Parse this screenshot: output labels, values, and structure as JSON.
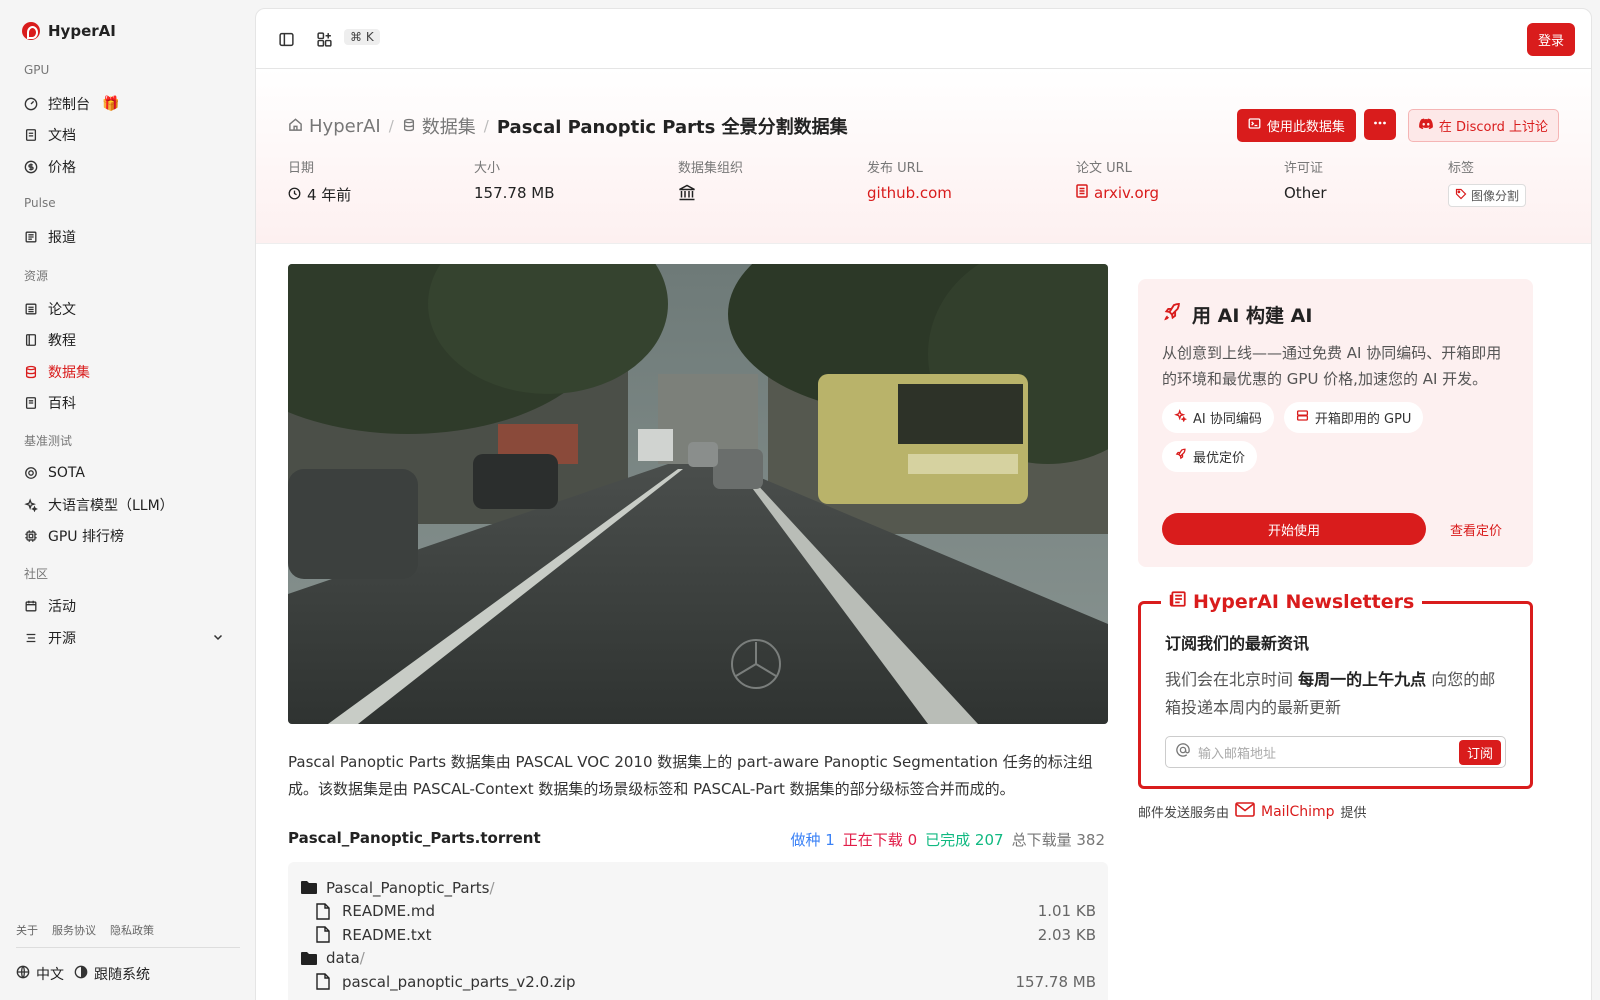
{
  "brand": {
    "name": "HyperAI"
  },
  "sidebar": {
    "sections": [
      {
        "title": "GPU",
        "items": [
          {
            "label": "控制台",
            "icon": "gauge-icon"
          },
          {
            "label": "文档",
            "icon": "doc-icon"
          },
          {
            "label": "价格",
            "icon": "dollar-icon"
          }
        ]
      },
      {
        "title": "Pulse",
        "items": [
          {
            "label": "报道",
            "icon": "news-icon"
          }
        ]
      },
      {
        "title": "资源",
        "items": [
          {
            "label": "论文",
            "icon": "paper-icon"
          },
          {
            "label": "教程",
            "icon": "book-icon"
          },
          {
            "label": "数据集",
            "icon": "database-icon"
          },
          {
            "label": "百科",
            "icon": "book-open-icon"
          }
        ]
      },
      {
        "title": "基准测试",
        "items": [
          {
            "label": "SOTA",
            "icon": "target-icon"
          },
          {
            "label": "大语言模型（LLM）",
            "icon": "sparkles-icon"
          },
          {
            "label": "GPU 排行榜",
            "icon": "cpu-icon"
          }
        ]
      },
      {
        "title": "社区",
        "items": [
          {
            "label": "活动",
            "icon": "calendar-icon"
          },
          {
            "label": "开源",
            "icon": "list-icon"
          }
        ]
      }
    ],
    "footer_links": [
      "关于",
      "服务协议",
      "隐私政策"
    ],
    "language": "中文",
    "theme": "跟随系统"
  },
  "topbar": {
    "shortcut": "⌘ K",
    "login": "登录"
  },
  "breadcrumb": {
    "home": "HyperAI",
    "section": "数据集",
    "current": "Pascal Panoptic Parts 全景分割数据集"
  },
  "actions": {
    "use_dataset": "使用此数据集",
    "discord": "在 Discord 上讨论"
  },
  "meta": {
    "date_label": "日期",
    "date_value": "4 年前",
    "size_label": "大小",
    "size_value": "157.78 MB",
    "org_label": "数据集组织",
    "release_label": "发布 URL",
    "release_value": "github.com",
    "paper_label": "论文 URL",
    "paper_value": "arxiv.org",
    "license_label": "许可证",
    "license_value": "Other",
    "tags_label": "标签",
    "tag_value": "图像分割"
  },
  "description": "Pascal Panoptic Parts 数据集由 PASCAL VOC 2010 数据集上的 part-aware Panoptic Segmentation 任务的标注组成。该数据集是由 PASCAL-Context 数据集的场景级标签和 PASCAL-Part 数据集的部分级标签合并而成的。",
  "torrent": {
    "name": "Pascal_Panoptic_Parts.torrent",
    "seeding_label": "做种",
    "seeding": "1",
    "downloading_label": "正在下载",
    "downloading": "0",
    "completed_label": "已完成",
    "completed": "207",
    "total_label": "总下载量",
    "total": "382",
    "files": [
      {
        "name": "Pascal_Panoptic_Parts",
        "type": "folder",
        "size": ""
      },
      {
        "name": "README.md",
        "type": "file",
        "size": "1.01 KB"
      },
      {
        "name": "README.txt",
        "type": "file",
        "size": "2.03 KB"
      },
      {
        "name": "data",
        "type": "folder",
        "size": ""
      },
      {
        "name": "pascal_panoptic_parts_v2.0.zip",
        "type": "file",
        "size": "157.78 MB"
      }
    ]
  },
  "ai_card": {
    "title": "用 AI 构建 AI",
    "description": "从创意到上线——通过免费 AI 协同编码、开箱即用的环境和最优惠的 GPU 价格,加速您的 AI 开发。",
    "chips": [
      "AI 协同编码",
      "开箱即用的 GPU",
      "最优定价"
    ],
    "start": "开始使用",
    "pricing": "查看定价"
  },
  "newsletter": {
    "legend": "HyperAI Newsletters",
    "heading": "订阅我们的最新资讯",
    "text_before": "我们会在北京时间 ",
    "text_bold": "每周一的上午九点",
    "text_after": " 向您的邮箱投递本周内的最新更新",
    "placeholder": "输入邮箱地址",
    "subscribe": "订阅",
    "provider_before": "邮件发送服务由",
    "provider": "MailChimp",
    "provider_after": "提供"
  },
  "colors": {
    "accent": "#d91c1c",
    "seeding": "#3b82f6",
    "downloading": "#e11d48",
    "completed": "#10b981"
  }
}
